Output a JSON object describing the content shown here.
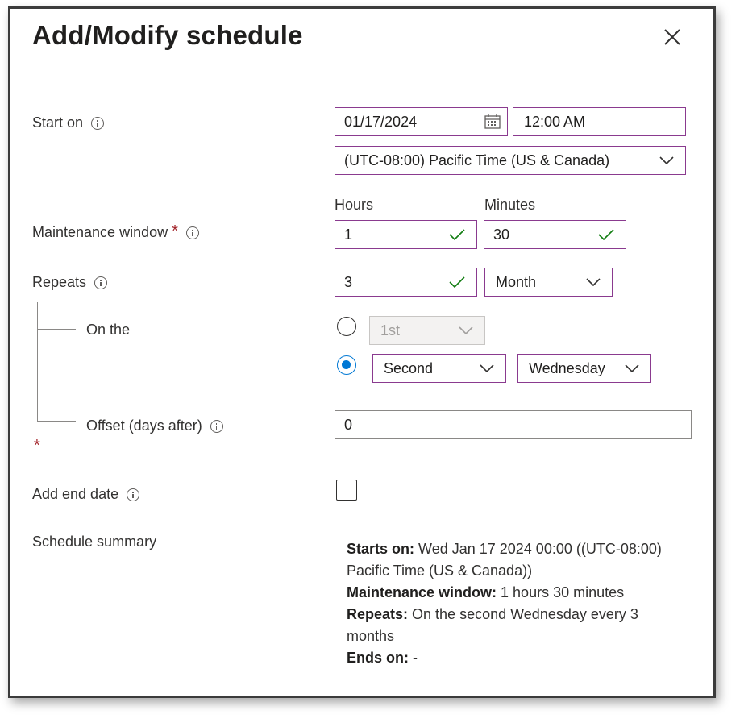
{
  "dialog": {
    "title": "Add/Modify schedule"
  },
  "start_on": {
    "label": "Start on",
    "date": "01/17/2024",
    "time": "12:00 AM",
    "timezone": "(UTC-08:00) Pacific Time (US & Canada)"
  },
  "maintenance_window": {
    "label": "Maintenance window",
    "required_mark": "*",
    "hours_label": "Hours",
    "minutes_label": "Minutes",
    "hours": "1",
    "minutes": "30"
  },
  "repeats": {
    "label": "Repeats",
    "count": "3",
    "unit": "Month"
  },
  "on_the": {
    "label": "On the",
    "day_of_month": "1st",
    "week_ordinal": "Second",
    "weekday": "Wednesday"
  },
  "offset": {
    "label": "Offset (days after)",
    "value": "0",
    "required_mark": "*"
  },
  "end_date": {
    "label": "Add end date"
  },
  "summary": {
    "label": "Schedule summary",
    "starts_on_label": "Starts on:",
    "starts_on_value": "Wed Jan 17 2024 00:00 ((UTC-08:00) Pacific Time (US & Canada))",
    "window_label": "Maintenance window:",
    "window_value": "1 hours 30 minutes",
    "repeats_label": "Repeats:",
    "repeats_value": "On the second Wednesday every 3 months",
    "ends_on_label": "Ends on:",
    "ends_on_value": "-"
  },
  "colors": {
    "accent": "#0078d4",
    "field_border": "#8a3a8f",
    "success": "#107c10",
    "required": "#a4262c"
  }
}
